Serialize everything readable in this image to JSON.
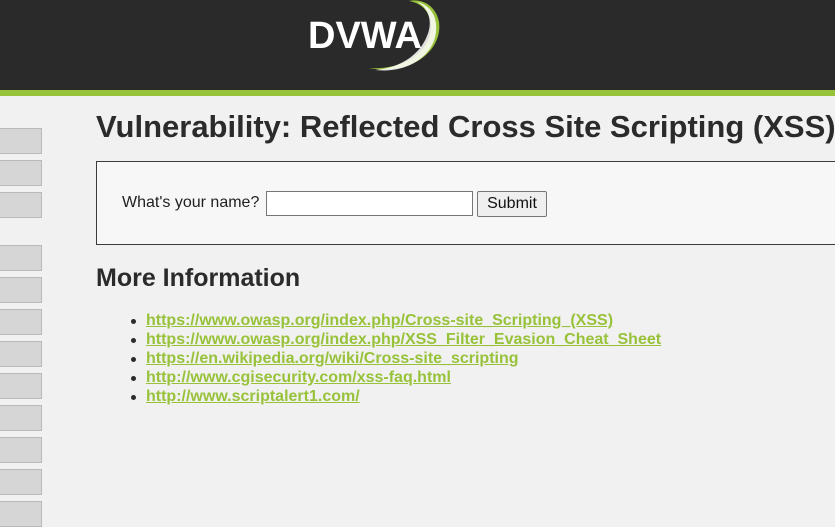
{
  "header": {
    "logo_text": "DVWA",
    "colors": {
      "bar": "#2a2a2a",
      "accent": "#98c23a"
    }
  },
  "side_menu": {
    "button_count": 12
  },
  "main": {
    "title": "Vulnerability: Reflected Cross Site Scripting (XSS)",
    "form": {
      "label": "What's your name?",
      "input_value": "",
      "submit_label": "Submit"
    },
    "more_info": {
      "heading": "More Information",
      "links": [
        "https://www.owasp.org/index.php/Cross-site_Scripting_(XSS)",
        "https://www.owasp.org/index.php/XSS_Filter_Evasion_Cheat_Sheet",
        "https://en.wikipedia.org/wiki/Cross-site_scripting",
        "http://www.cgisecurity.com/xss-faq.html",
        "http://www.scriptalert1.com/"
      ]
    }
  }
}
